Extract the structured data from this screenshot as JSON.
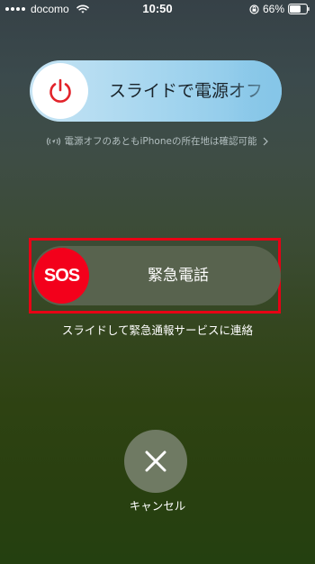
{
  "status_bar": {
    "carrier": "docomo",
    "time": "10:50",
    "battery_percent": "66%",
    "battery_level": 0.66,
    "icons": [
      "signal-dots-icon",
      "wifi-icon",
      "rotation-lock-icon",
      "battery-icon"
    ]
  },
  "power_slider": {
    "label": "スライドで電源オフ",
    "icon": "power-icon",
    "accent_color": "#e2232a"
  },
  "find_my": {
    "text": "電源オフのあともiPhoneの所在地は確認可能",
    "icon": "find-my-location-icon",
    "chevron": "chevron-right-icon"
  },
  "sos_slider": {
    "knob_label": "SOS",
    "label": "緊急電話",
    "caption": "スライドして緊急通報サービスに連絡",
    "knob_color": "#f3001b",
    "highlight_color": "#e80015"
  },
  "cancel": {
    "label": "キャンセル",
    "icon": "close-icon"
  }
}
